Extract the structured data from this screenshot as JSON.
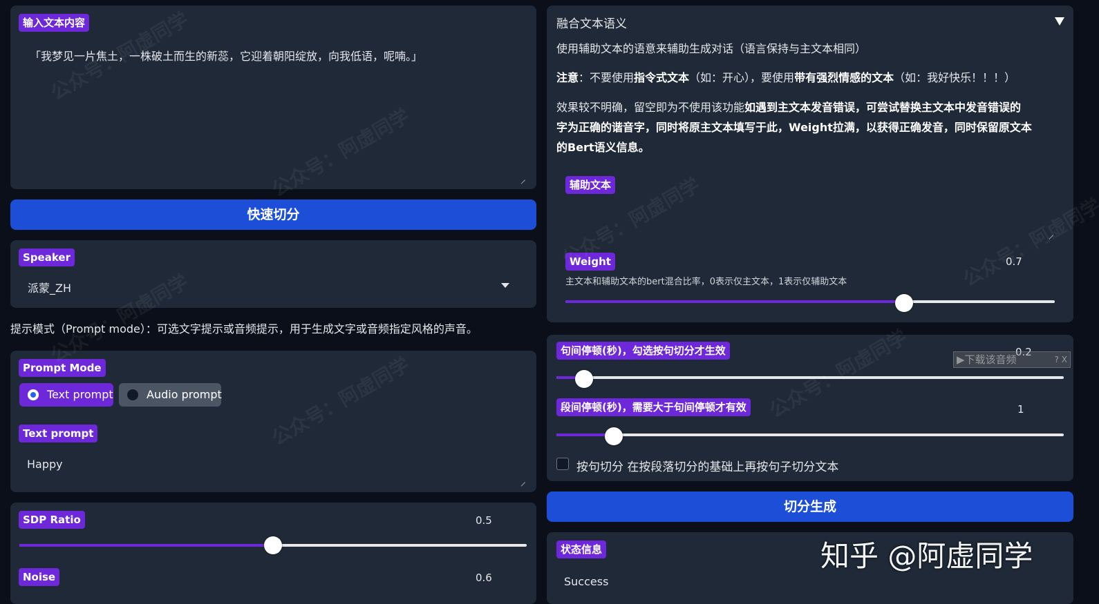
{
  "left": {
    "input_label": "输入文本内容",
    "input_value": "「我梦见一片焦土，一株破土而生的新蕊，它迎着朝阳绽放，向我低语，呢喃。」",
    "quick_split_button": "快速切分",
    "speaker": {
      "label": "Speaker",
      "value": "派蒙_ZH"
    },
    "prompt_mode_hint": "提示模式（Prompt mode）：可选文字提示或音频提示，用于生成文字或音频指定风格的声音。",
    "prompt_mode": {
      "label": "Prompt Mode",
      "options": [
        "Text prompt",
        "Audio prompt"
      ],
      "selected": "Text prompt"
    },
    "text_prompt": {
      "label": "Text prompt",
      "value": "Happy"
    },
    "sdp_ratio": {
      "label": "SDP Ratio",
      "value": 0.5,
      "value_text": "0.5"
    },
    "noise": {
      "label": "Noise",
      "value_text": "0.6"
    }
  },
  "right": {
    "fusion_title": "融合文本语义",
    "fusion_desc": "使用辅助文本的语意来辅助生成对话（语言保持与主文本相同）",
    "note": {
      "p1": "注意",
      "p2": "：不要使用",
      "p3": "指令式文本",
      "p4": "（如：开心），要使用",
      "p5": "带有强烈情感的文本",
      "p6": "（如：我好快乐！！！）"
    },
    "effect": {
      "normal": "效果较不明确，留空即为不使用该功能",
      "bold_line1": "如遇到主文本发音错误，可尝试替换主文本中发音错误的",
      "bold_line2": "字为正确的谐音字，同时将原主文本填写于此，Weight拉满，以获得正确发音，同时保留原文本",
      "bold_line3": "的Bert语义信息。"
    },
    "aux_label": "辅助文本",
    "weight": {
      "label": "Weight",
      "value": 0.7,
      "value_text": "0.7",
      "desc": "主文本和辅助文本的bert混合比率，0表示仅主文本，1表示仅辅助文本"
    },
    "sentence_pause": {
      "label": "句间停顿(秒)，勾选按句切分才生效",
      "value_text": "0.2",
      "fill": 0.05
    },
    "para_pause": {
      "label": "段间停顿(秒)，需要大于句间停顿才有效",
      "value_text": "1",
      "fill": 0.11
    },
    "sentence_split": {
      "label": "按句切分",
      "desc": "在按段落切分的基础上再按句子切分文本",
      "checked": false
    },
    "split_generate_button": "切分生成",
    "status": {
      "label": "状态信息",
      "value": "Success"
    },
    "download_overlay": "▶下载该音频",
    "download_overlay_icons": "? X"
  },
  "watermark": "公众号：阿虚同学",
  "corner_brand": "知乎 @阿虚同学"
}
